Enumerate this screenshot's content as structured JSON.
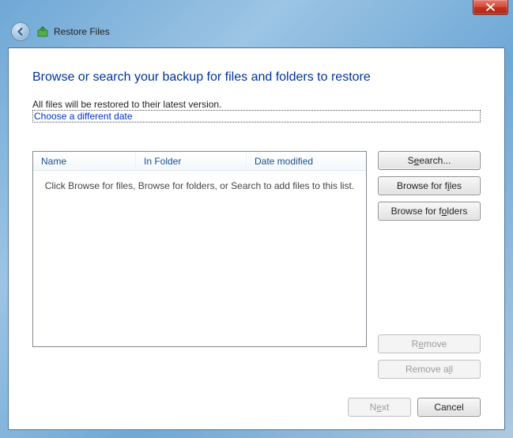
{
  "window": {
    "title": "Restore Files"
  },
  "page": {
    "heading": "Browse or search your backup for files and folders to restore",
    "subtext": "All files will be restored to their latest version.",
    "choose_date_link": "Choose a different date"
  },
  "list": {
    "columns": {
      "name": "Name",
      "folder": "In Folder",
      "date": "Date modified"
    },
    "empty_text": "Click Browse for files, Browse for folders, or Search to add files to this list.",
    "rows": []
  },
  "buttons": {
    "search_pre": "S",
    "search_post": "earch...",
    "browse_files_pre": "Browse for f",
    "browse_files_post": "les",
    "browse_folders_pre": "Browse for f",
    "browse_folders_post": "lders",
    "remove_pre": "R",
    "remove_post": "move",
    "remove_all_pre": "Remove a",
    "remove_all_post": "l",
    "next_pre": "N",
    "next_post": "xt",
    "cancel": "Cancel",
    "underline": {
      "search": "e",
      "files": "i",
      "folders": "o",
      "remove": "e",
      "removeall": "l",
      "next": "e"
    }
  },
  "state": {
    "remove_enabled": false,
    "remove_all_enabled": false,
    "next_enabled": false
  }
}
